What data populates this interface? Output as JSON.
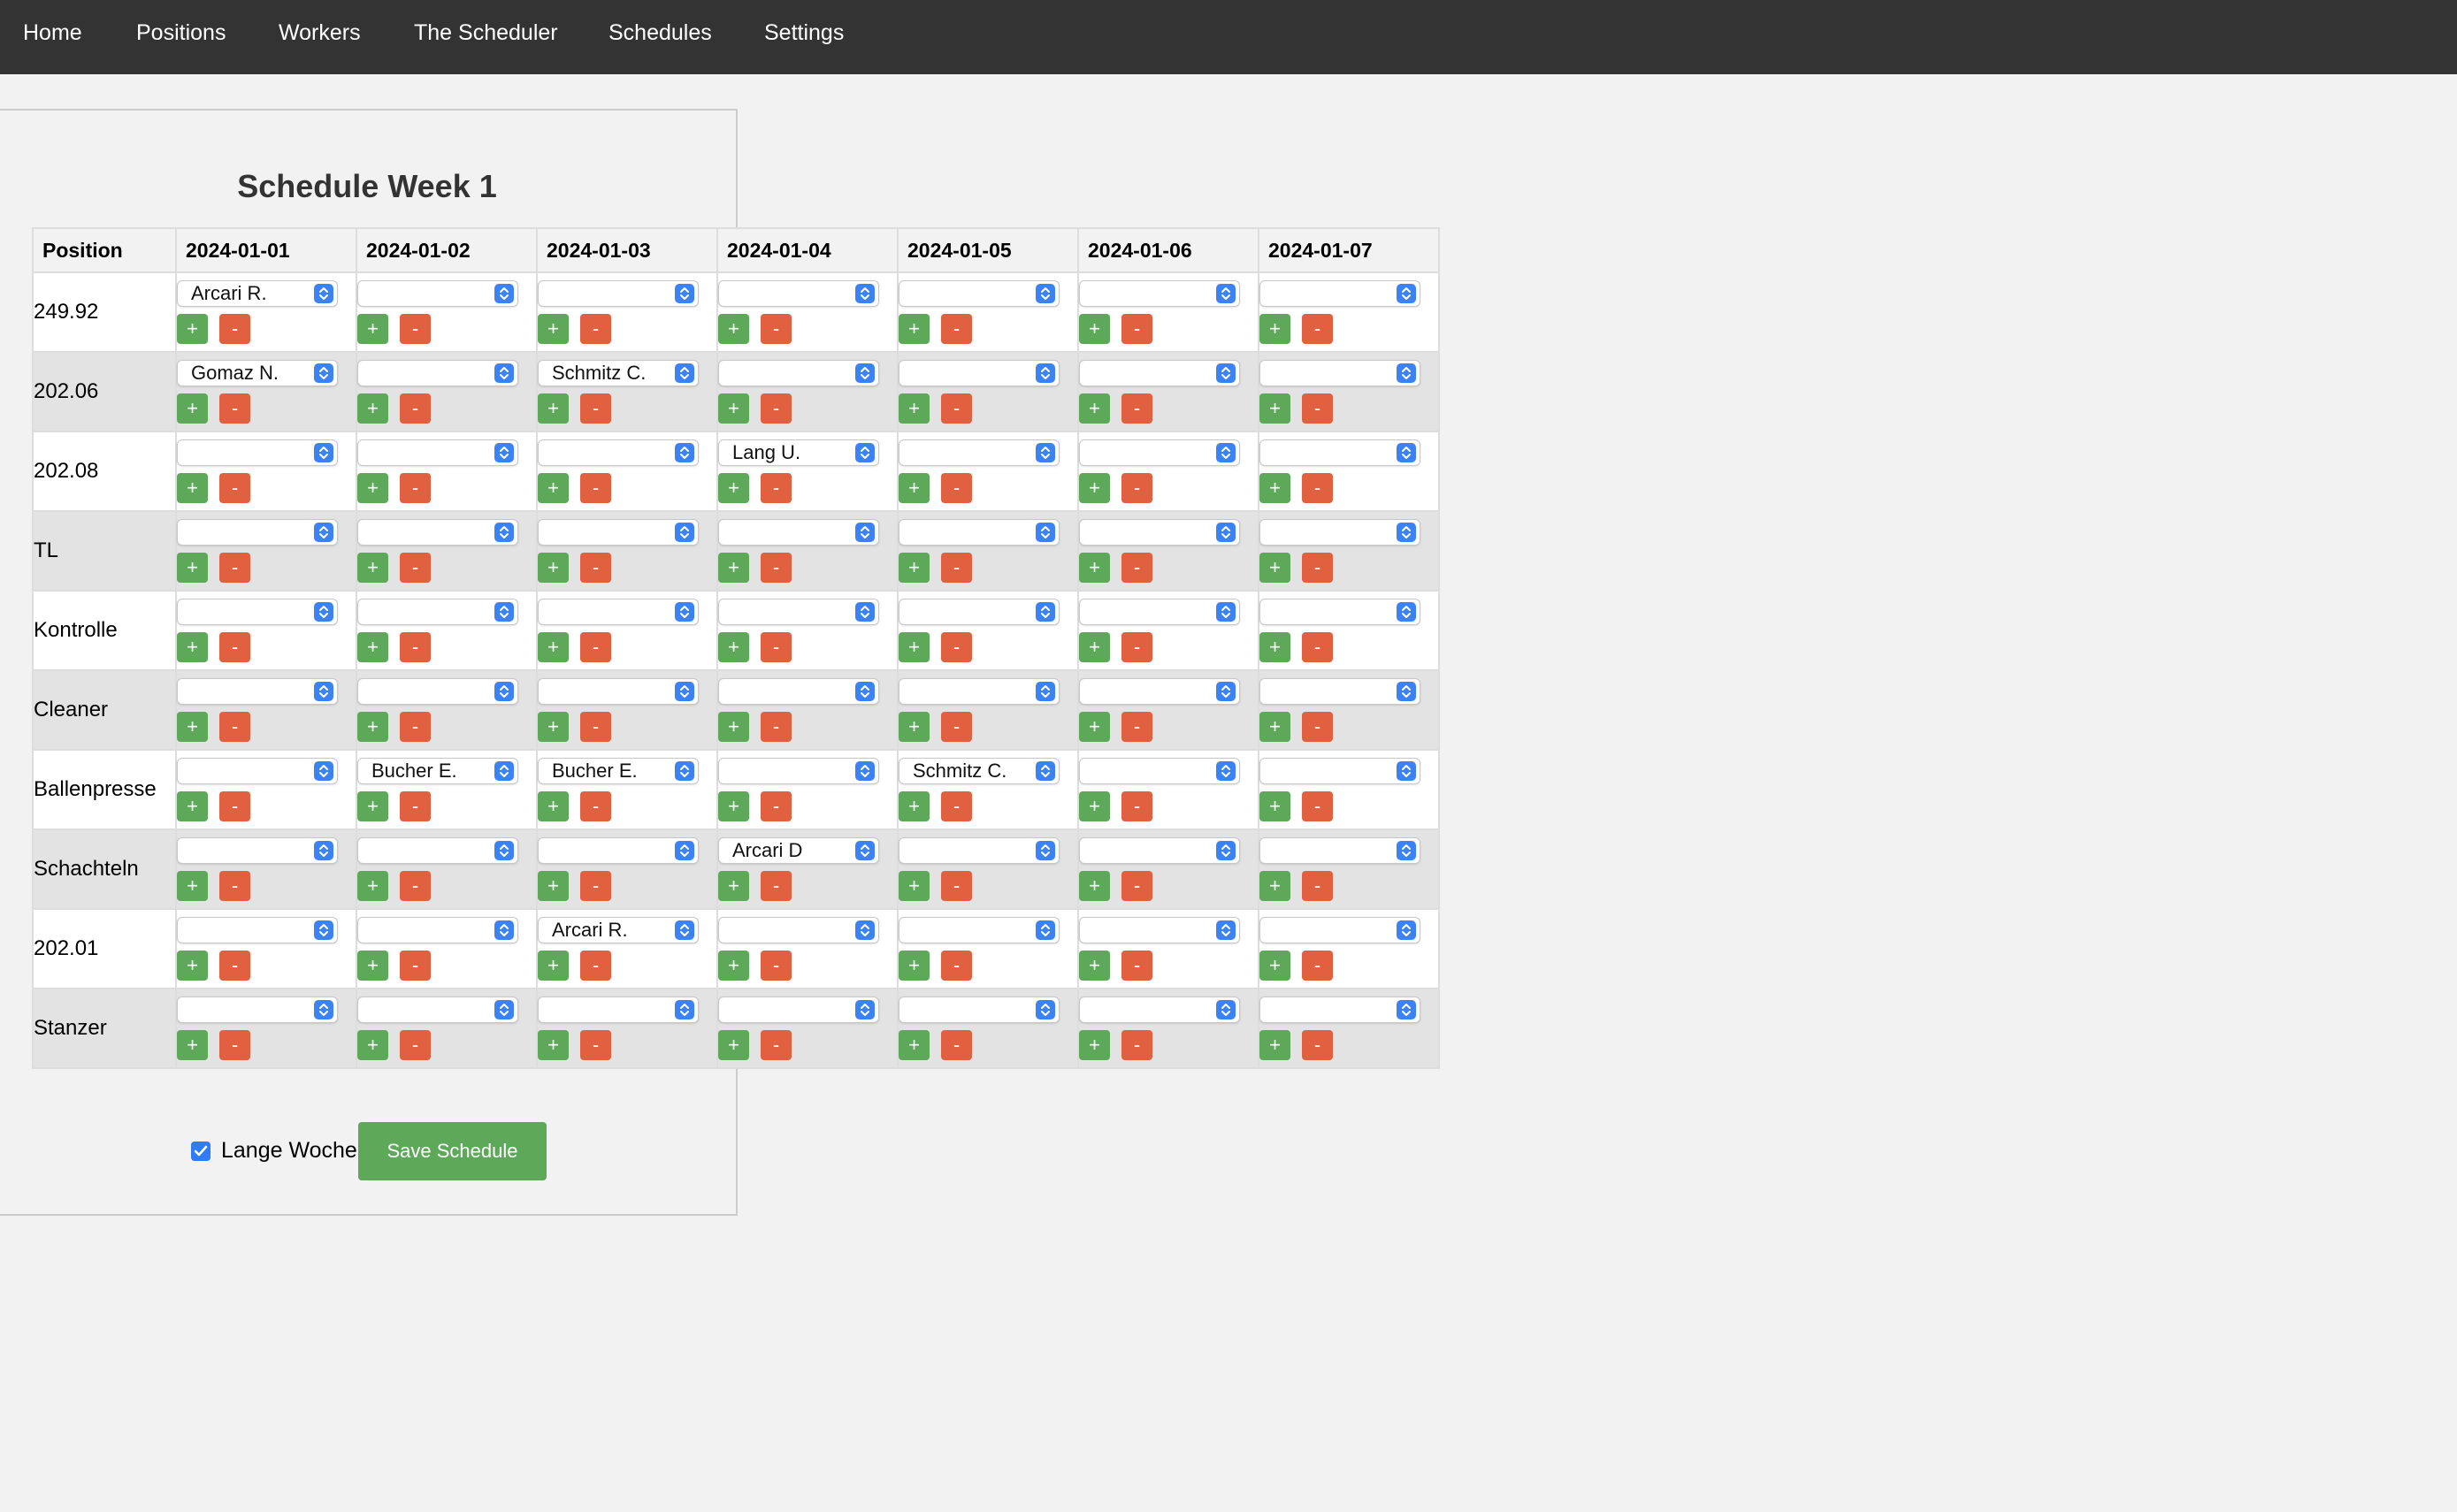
{
  "nav": {
    "items": [
      "Home",
      "Positions",
      "Workers",
      "The Scheduler",
      "Schedules",
      "Settings"
    ]
  },
  "schedule": {
    "title": "Schedule Week 1",
    "position_header": "Position",
    "dates": [
      "2024-01-01",
      "2024-01-02",
      "2024-01-03",
      "2024-01-04",
      "2024-01-05",
      "2024-01-06",
      "2024-01-07"
    ],
    "rows": [
      {
        "position": "249.92",
        "assignments": [
          "Arcari R.",
          "",
          "",
          "",
          "",
          "",
          ""
        ]
      },
      {
        "position": "202.06",
        "assignments": [
          "Gomaz N.",
          "",
          "Schmitz C.",
          "",
          "",
          "",
          ""
        ]
      },
      {
        "position": "202.08",
        "assignments": [
          "",
          "",
          "",
          "Lang U.",
          "",
          "",
          ""
        ]
      },
      {
        "position": "TL",
        "assignments": [
          "",
          "",
          "",
          "",
          "",
          "",
          ""
        ]
      },
      {
        "position": "Kontrolle",
        "assignments": [
          "",
          "",
          "",
          "",
          "",
          "",
          ""
        ]
      },
      {
        "position": "Cleaner",
        "assignments": [
          "",
          "",
          "",
          "",
          "",
          "",
          ""
        ]
      },
      {
        "position": "Ballenpresse",
        "assignments": [
          "",
          "Bucher E.",
          "Bucher E.",
          "",
          "Schmitz C.",
          "",
          ""
        ]
      },
      {
        "position": "Schachteln",
        "assignments": [
          "",
          "",
          "",
          "Arcari D",
          "",
          "",
          ""
        ]
      },
      {
        "position": "202.01",
        "assignments": [
          "",
          "",
          "Arcari R.",
          "",
          "",
          "",
          ""
        ]
      },
      {
        "position": "Stanzer",
        "assignments": [
          "",
          "",
          "",
          "",
          "",
          "",
          ""
        ]
      }
    ],
    "add_label": "+",
    "remove_label": "-"
  },
  "footer": {
    "long_week_label": "Lange Woche",
    "long_week_checked": true,
    "save_label": "Save Schedule"
  },
  "colors": {
    "navbar": "#333333",
    "add_button": "#5ea85a",
    "remove_button": "#e0603f",
    "select_chevron": "#3b82f6",
    "save_button": "#5ea85a"
  },
  "icons": {
    "select_chevron": "updown-chevron-icon",
    "checkbox": "checkmark-icon"
  }
}
